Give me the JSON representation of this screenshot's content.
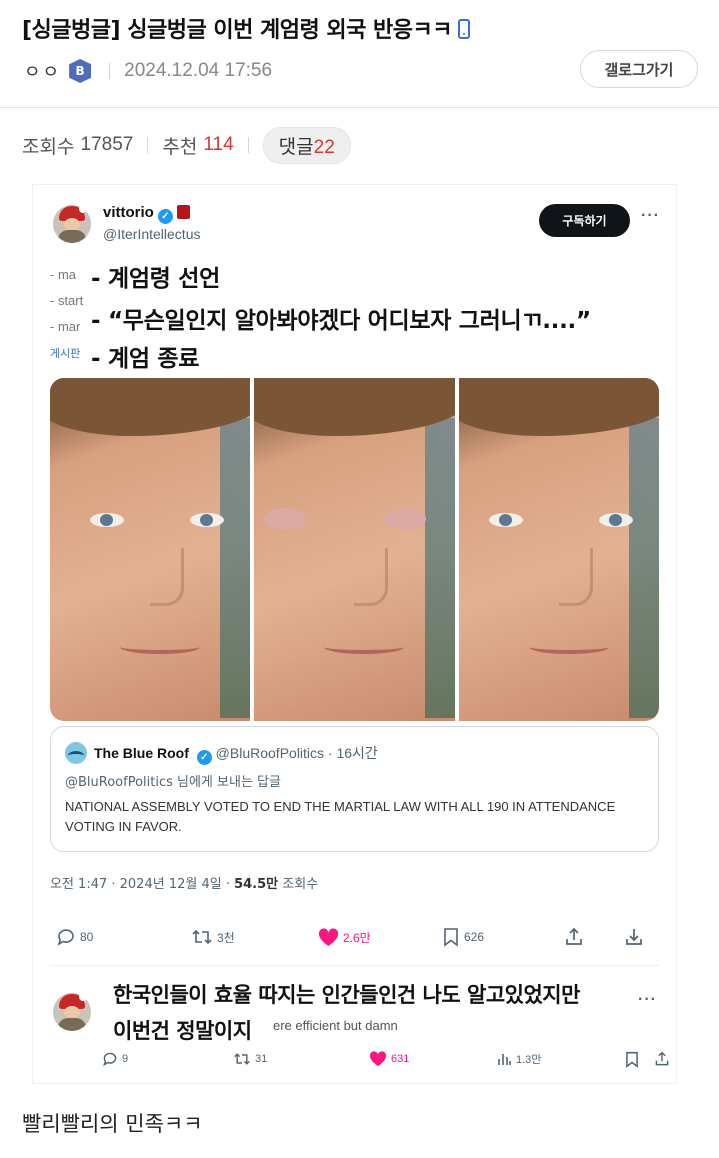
{
  "post": {
    "title": "[싱글벙글] 싱글벙글 이번 계엄령 외국 반응ㅋㅋ",
    "title_icon": "mobile-phone-icon",
    "author": "ㅇㅇ",
    "level_badge": "B",
    "date": "2024.12.04 17:56",
    "back_button": "갤로그가기"
  },
  "stats": {
    "views_label": "조회수",
    "views": "17857",
    "recommend_label": "추천",
    "recommend": "114",
    "comments_label": "댓글",
    "comments": "22"
  },
  "tweet": {
    "name": "vittorio",
    "handle": "@IterIntellectus",
    "subscribe_button": "구독하기",
    "more": "···",
    "ghost_lines": [
      "- ma",
      "- start",
      "- mar",
      "게시판"
    ],
    "overlay_lines": [
      "- 계엄령 선언",
      "- “무슨일인지 알아봐야겠다 어디보자 그러니ㄲ....”",
      "- 계엄 종료"
    ],
    "quote": {
      "name": "The Blue Roof",
      "handle": "@BluRoofPolitics · 16시간",
      "reply_to": "@BluRoofPolitics 님에게 보내는 답글",
      "text": "NATIONAL ASSEMBLY VOTED TO END THE MARTIAL LAW WITH ALL 190 IN ATTENDANCE VOTING IN FAVOR."
    },
    "timestamp_prefix": "오전 1:47 · 2024년 12월 4일 · ",
    "views_count": "54.5만",
    "views_suffix": " 조회수",
    "actions": {
      "replies": "80",
      "retweets": "3천",
      "likes": "2.6만",
      "bookmarks": "626"
    },
    "accent_like": "#f91880",
    "accent_verified": "#1d9bf0"
  },
  "reply_tweet": {
    "ghost_text": "ere efficient but damn",
    "overlay_lines": [
      "한국인들이 효율 따지는 인간들인건 나도 알고있었지만",
      "이번건 정말이지"
    ],
    "more": "···",
    "actions": {
      "replies": "9",
      "retweets": "31",
      "likes": "631",
      "views": "1.3만"
    }
  },
  "caption": "빨리빨리의 민족ㅋㅋ"
}
